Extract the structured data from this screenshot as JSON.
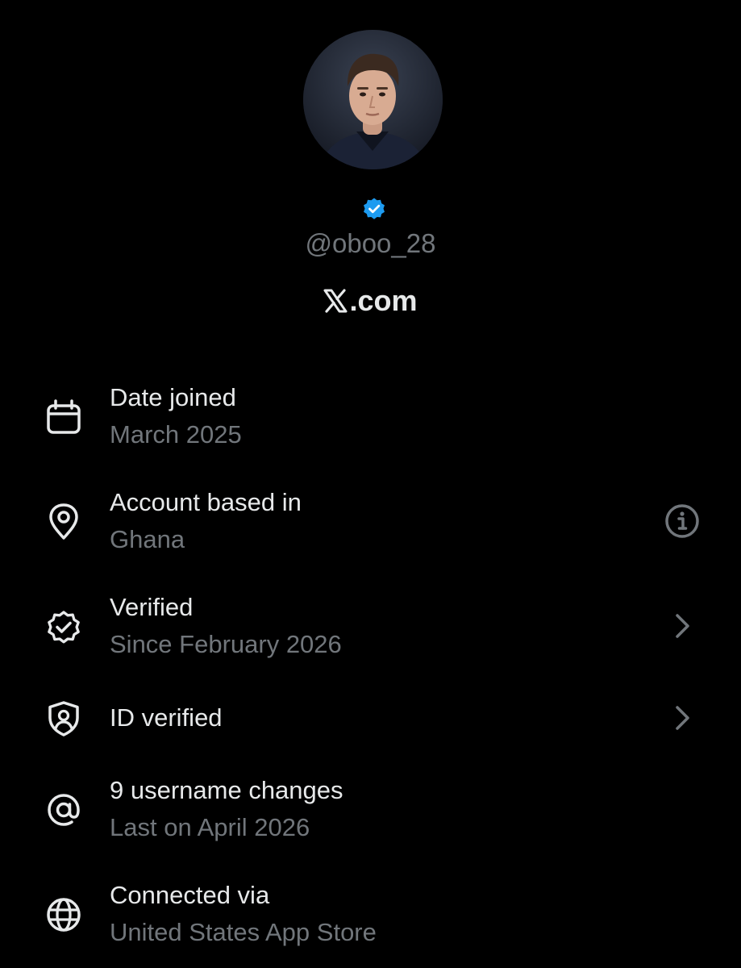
{
  "profile": {
    "handle": "@oboo_28",
    "site": ".com",
    "verified_badge_color": "#1d9bf0"
  },
  "details": [
    {
      "icon": "calendar-icon",
      "title": "Date joined",
      "subtitle": "March 2025",
      "trailing": ""
    },
    {
      "icon": "location-pin-icon",
      "title": "Account based in",
      "subtitle": "Ghana",
      "trailing": "info-icon"
    },
    {
      "icon": "verified-check-icon",
      "title": "Verified",
      "subtitle": "Since February 2026",
      "trailing": "chevron-right-icon"
    },
    {
      "icon": "shield-person-icon",
      "title": "ID verified",
      "subtitle": "",
      "trailing": "chevron-right-icon"
    },
    {
      "icon": "at-sign-icon",
      "title": "9 username changes",
      "subtitle": "Last on April 2026",
      "trailing": ""
    },
    {
      "icon": "globe-icon",
      "title": "Connected via",
      "subtitle": "United States App Store",
      "trailing": ""
    }
  ],
  "colors": {
    "background": "#000000",
    "primary_text": "#e7e9ea",
    "secondary_text": "#71767b"
  }
}
